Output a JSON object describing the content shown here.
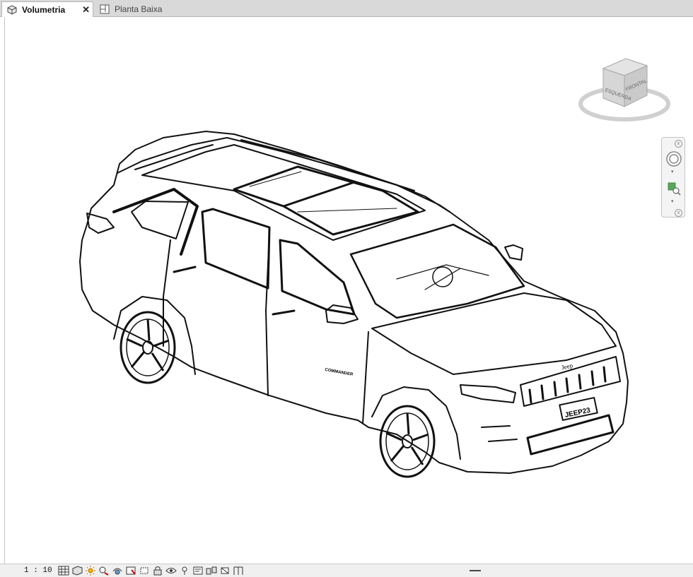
{
  "tabs": [
    {
      "label": "Volumetria",
      "active": true,
      "icon": "3d-view-icon"
    },
    {
      "label": "Planta Baixa",
      "active": false,
      "icon": "floor-plan-icon"
    }
  ],
  "viewcube": {
    "faces": [
      "ESQUERDA",
      "FRONTAL"
    ]
  },
  "car": {
    "badge": "Jeep",
    "plate": "JEEP23",
    "model_badge": "COMMANDER"
  },
  "status": {
    "scale": "1 : 10"
  },
  "colors": {
    "tab_bar": "#d9d9d9",
    "line": "#111111",
    "viewcube": "#d6d6d6",
    "accent": "#3b8f3b"
  }
}
